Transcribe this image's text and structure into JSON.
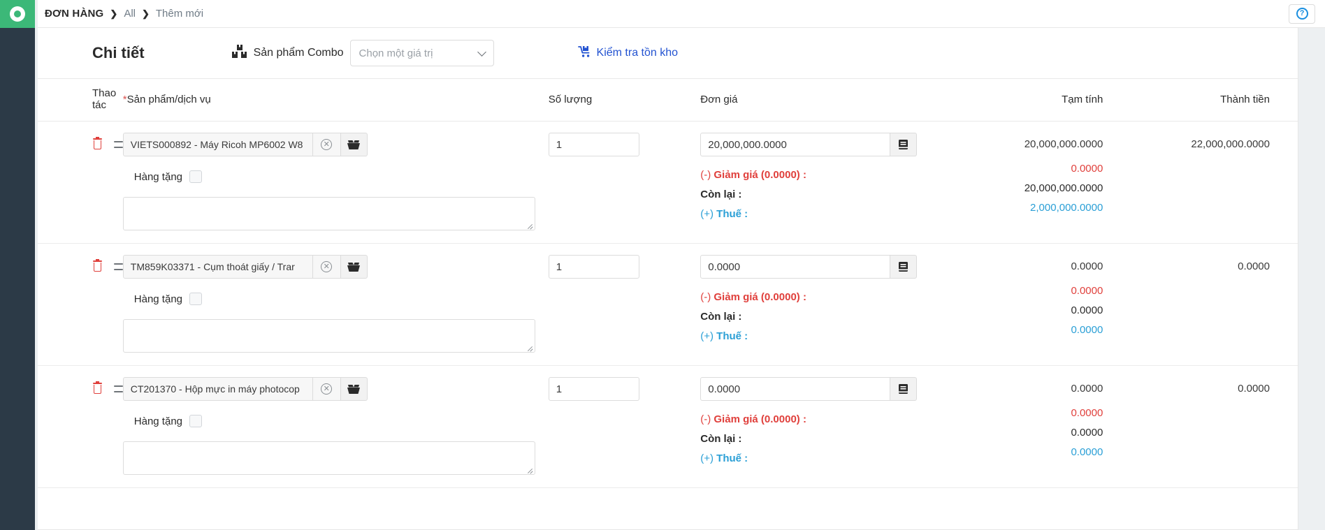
{
  "topbar": {
    "breadcrumb": {
      "root": "ĐƠN HÀNG",
      "sep": "❯",
      "middle": "All",
      "current": "Thêm mới"
    },
    "help_glyph": "?"
  },
  "section": {
    "title": "Chi tiết",
    "combo_label": "Sản phẩm Combo",
    "combo_placeholder": "Chọn một giá trị",
    "stock_link": "Kiểm tra tồn kho"
  },
  "table": {
    "headers": {
      "action": "Thao tác",
      "product_required": "*",
      "product": "Sản phẩm/dịch vụ",
      "quantity": "Số lượng",
      "unit_price": "Đơn giá",
      "subtotal": "Tạm tính",
      "total": "Thành tiền"
    },
    "labels": {
      "gift": "Hàng tặng",
      "discount": "(-) Giảm giá (0.0000) :",
      "discount_prefix": "(-) ",
      "discount_text": "Giảm giá (0.0000) :",
      "remaining": "Còn lại :",
      "tax_prefix": "(+) ",
      "tax_text": "Thuế :"
    },
    "rows": [
      {
        "product": "VIETS000892 - Máy Ricoh MP6002 W8",
        "quantity": "1",
        "unit_price": "20,000,000.0000",
        "subtotal": "20,000,000.0000",
        "total": "22,000,000.0000",
        "discount_value": "0.0000",
        "remaining_value": "20,000,000.0000",
        "tax_value": "2,000,000.0000",
        "note": ""
      },
      {
        "product": "TM859K03371 - Cụm thoát giấy  / Trar",
        "quantity": "1",
        "unit_price": "0.0000",
        "subtotal": "0.0000",
        "total": "0.0000",
        "discount_value": "0.0000",
        "remaining_value": "0.0000",
        "tax_value": "0.0000",
        "note": ""
      },
      {
        "product": "CT201370 - Hộp mực in máy photocop",
        "quantity": "1",
        "unit_price": "0.0000",
        "subtotal": "0.0000",
        "total": "0.0000",
        "discount_value": "0.0000",
        "remaining_value": "0.0000",
        "tax_value": "0.0000",
        "note": ""
      }
    ]
  },
  "colors": {
    "rail": "#2c3a47",
    "logo_green": "#3cb878",
    "link_blue": "#2353d1",
    "tax_blue": "#2a9fd6",
    "discount_red": "#e0403c",
    "help_blue": "#1a8fe0"
  }
}
